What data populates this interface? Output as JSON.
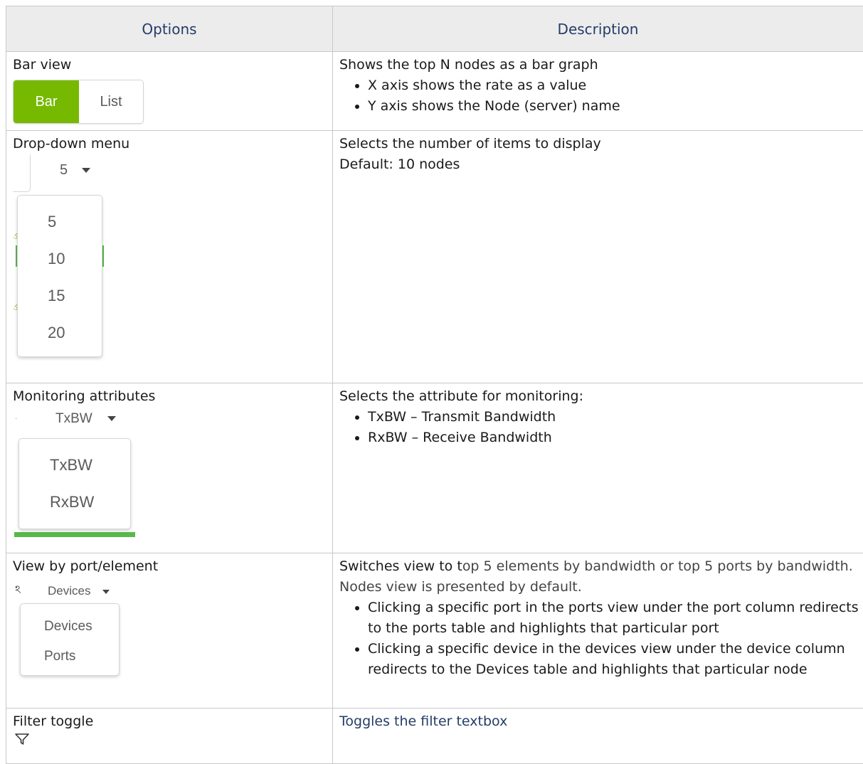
{
  "header": {
    "options": "Options",
    "description": "Description"
  },
  "rows": {
    "bar_view": {
      "option": "Bar view",
      "toggle": {
        "active": "Bar",
        "inactive": "List",
        "active_color": "#76b900"
      },
      "description": "Shows the top N nodes as a bar graph",
      "bullets": [
        "X axis shows the rate as a value",
        "Y axis shows the Node (server) name"
      ]
    },
    "drop_down": {
      "option": "Drop-down menu",
      "selected": "5",
      "menu_items": [
        "5",
        "10",
        "15",
        "20"
      ],
      "description": "Selects the number of items to display",
      "default_text": "Default: 10 nodes"
    },
    "monitoring": {
      "option": "Monitoring attributes",
      "selected": "TxBW",
      "menu_items": [
        "TxBW",
        "RxBW"
      ],
      "description": "Selects the attribute for monitoring:",
      "bullets": [
        "TxBW – Transmit Bandwidth",
        "RxBW – Receive Bandwidth"
      ]
    },
    "view_by": {
      "option": "View by port/element",
      "selected": "Devices",
      "menu_items": [
        "Devices",
        "Ports"
      ],
      "description_a": "Switches view to t",
      "description_b": "op 5 elements by bandwidth or top 5 ports by bandwidth. Nodes view is presented by default.",
      "bullets": [
        "Clicking a specific port in the ports view under the port column redirects to the ports table and highlights that particular port",
        "Clicking a specific device in the devices view under the device column redirects to the Devices table and highlights that particular node"
      ]
    },
    "filter": {
      "option": "Filter toggle",
      "icon": "filter-icon",
      "description": "Toggles the filter textbox"
    }
  },
  "colors": {
    "header_text": "#243d66",
    "header_bg": "#ececec",
    "accent_green": "#76b900"
  }
}
